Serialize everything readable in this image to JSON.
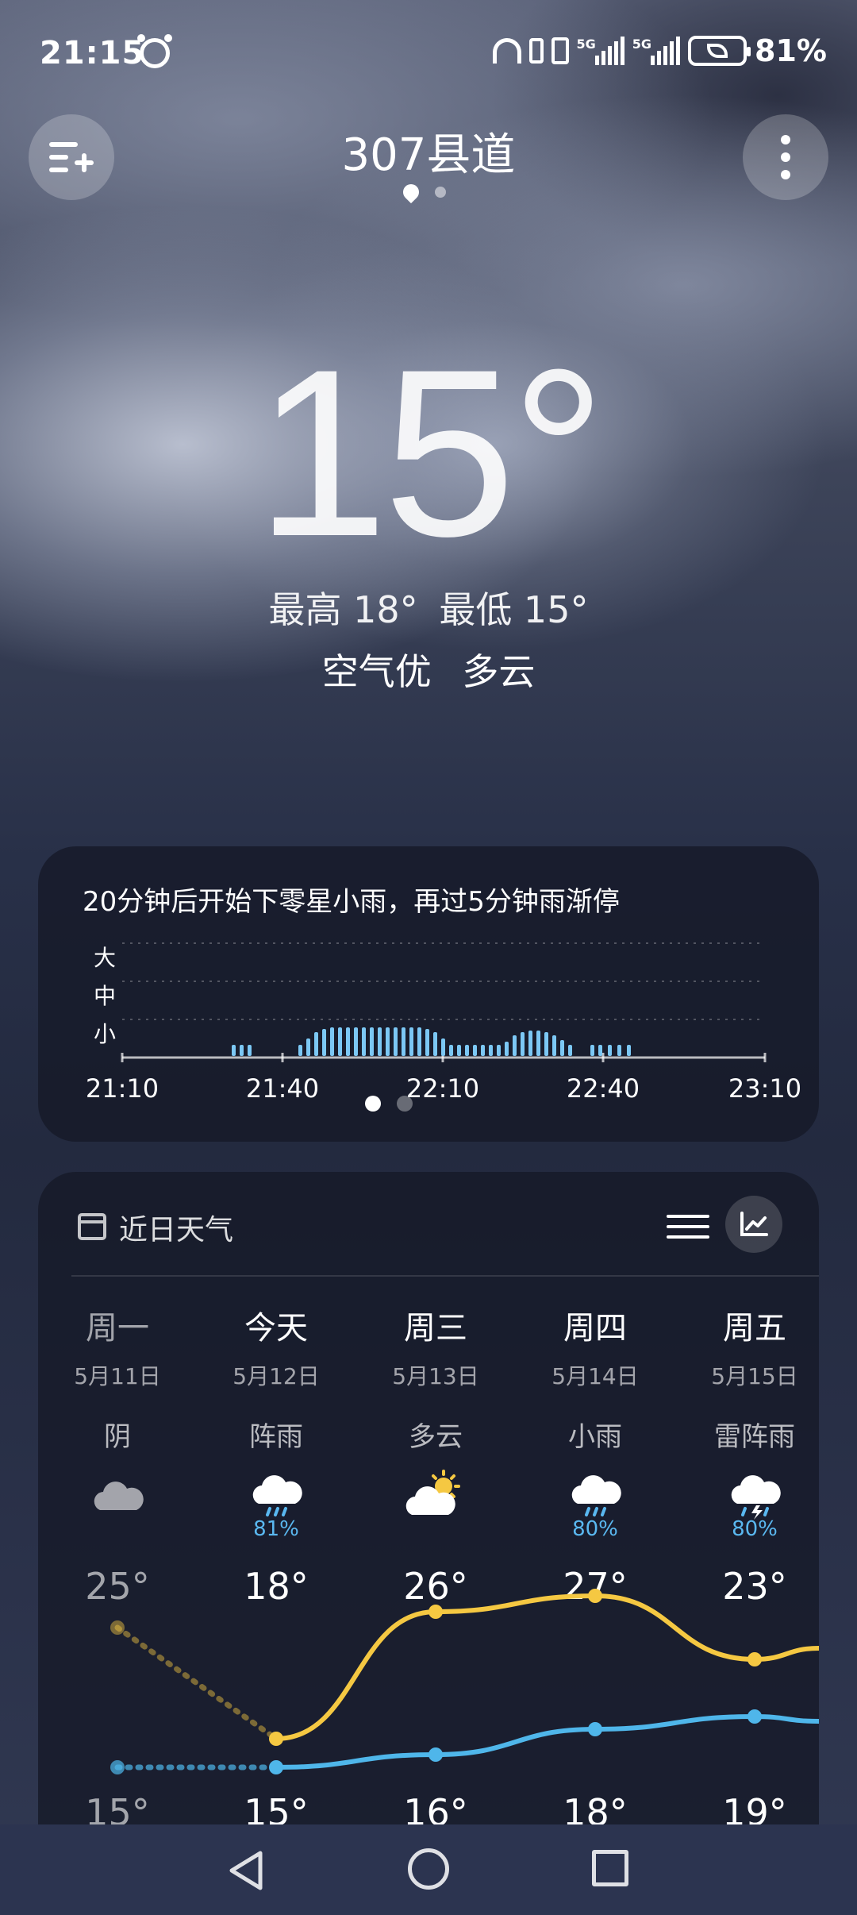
{
  "status": {
    "time": "21:15",
    "battery": "81%",
    "network_tags": [
      "5G",
      "5G"
    ]
  },
  "header": {
    "location": "307县道"
  },
  "current": {
    "temp": "15°",
    "high": "最高 18°",
    "low": "最低 15°",
    "air": "空气优",
    "condition": "多云"
  },
  "rain": {
    "summary": "20分钟后开始下零星小雨，再过5分钟雨渐停",
    "levels": [
      "大",
      "中",
      "小"
    ],
    "times": [
      "21:10",
      "21:40",
      "22:10",
      "22:40",
      "23:10"
    ]
  },
  "forecast": {
    "title": "近日天气",
    "days": [
      {
        "name": "周一",
        "date": "5月11日",
        "cond": "阴",
        "prob": "",
        "high": "25°",
        "low": "15°",
        "icon": "cloudy-icon"
      },
      {
        "name": "今天",
        "date": "5月12日",
        "cond": "阵雨",
        "prob": "81%",
        "high": "18°",
        "low": "15°",
        "icon": "shower-icon"
      },
      {
        "name": "周三",
        "date": "5月13日",
        "cond": "多云",
        "prob": "",
        "high": "26°",
        "low": "16°",
        "icon": "partly-cloudy-icon"
      },
      {
        "name": "周四",
        "date": "5月14日",
        "cond": "小雨",
        "prob": "80%",
        "high": "27°",
        "low": "18°",
        "icon": "light-rain-icon"
      },
      {
        "name": "周五",
        "date": "5月15日",
        "cond": "雷阵雨",
        "prob": "80%",
        "high": "23°",
        "low": "19°",
        "icon": "thunderstorm-icon"
      }
    ]
  },
  "colors": {
    "high_line": "#f5c842",
    "low_line": "#4fb6ea",
    "rain_bar": "#7cc8f5"
  }
}
